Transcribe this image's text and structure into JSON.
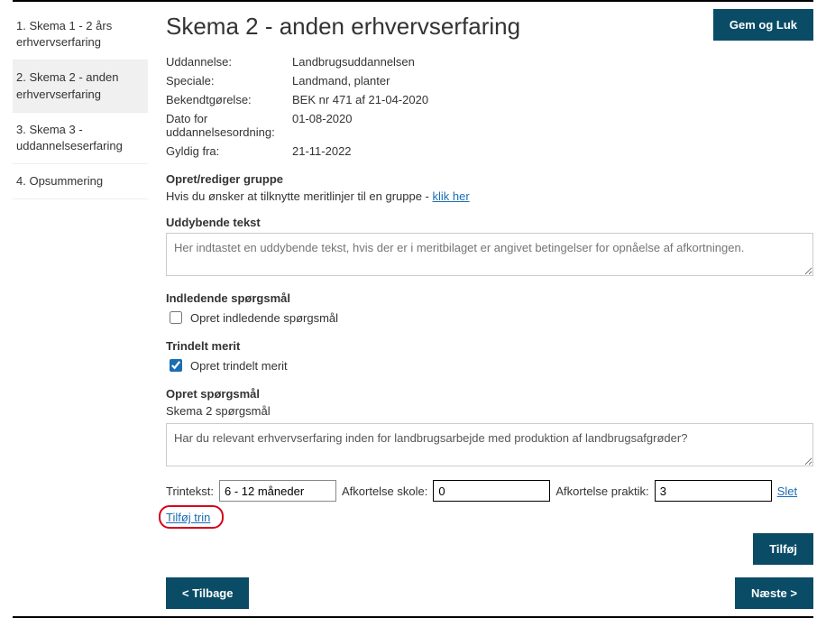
{
  "sidebar": {
    "items": [
      {
        "label": "1. Skema 1 - 2 års erhvervserfaring"
      },
      {
        "label": "2. Skema 2 - anden erhvervserfaring"
      },
      {
        "label": "3. Skema 3 - uddannelseserfaring"
      },
      {
        "label": "4. Opsummering"
      }
    ]
  },
  "header": {
    "title": "Skema 2 - anden erhvervserfaring",
    "save_close_label": "Gem og Luk"
  },
  "info": {
    "uddannelse_label": "Uddannelse:",
    "uddannelse_value": "Landbrugsuddannelsen",
    "speciale_label": "Speciale:",
    "speciale_value": "Landmand, planter",
    "bekendtgoerelse_label": "Bekendtgørelse:",
    "bekendtgoerelse_value": "BEK nr 471 af 21-04-2020",
    "dato_label": "Dato for uddannelsesordning:",
    "dato_value": "01-08-2020",
    "gyldig_label": "Gyldig fra:",
    "gyldig_value": "21-11-2022"
  },
  "group": {
    "title": "Opret/rediger gruppe",
    "helper_prefix": "Hvis du ønsker at tilknytte meritlinjer til en gruppe - ",
    "link_text": "klik her"
  },
  "uddybende": {
    "title": "Uddybende tekst",
    "placeholder": "Her indtastet en uddybende tekst, hvis der er i meritbilaget er angivet betingelser for opnåelse af afkortningen."
  },
  "indledende": {
    "title": "Indledende spørgsmål",
    "checkbox_label": "Opret indledende spørgsmål"
  },
  "trindelt": {
    "title": "Trindelt merit",
    "checkbox_label": "Opret trindelt merit"
  },
  "opret_spg": {
    "title": "Opret spørgsmål",
    "subtitle": "Skema 2 spørgsmål",
    "textarea_value": "Har du relevant erhvervserfaring inden for landbrugsarbejde med produktion af landbrugsafgrøder?"
  },
  "trin": {
    "trintekst_label": "Trintekst:",
    "trintekst_value": "6 - 12 måneder",
    "afk_skole_label": "Afkortelse skole:",
    "afk_skole_value": "0",
    "afk_praktik_label": "Afkortelse praktik:",
    "afk_praktik_value": "3",
    "slet_label": "Slet",
    "tilfoj_trin_label": "Tilføj trin"
  },
  "buttons": {
    "tilfoj_label": "Tilføj",
    "tilbage_label": "< Tilbage",
    "naeste_label": "Næste >"
  }
}
